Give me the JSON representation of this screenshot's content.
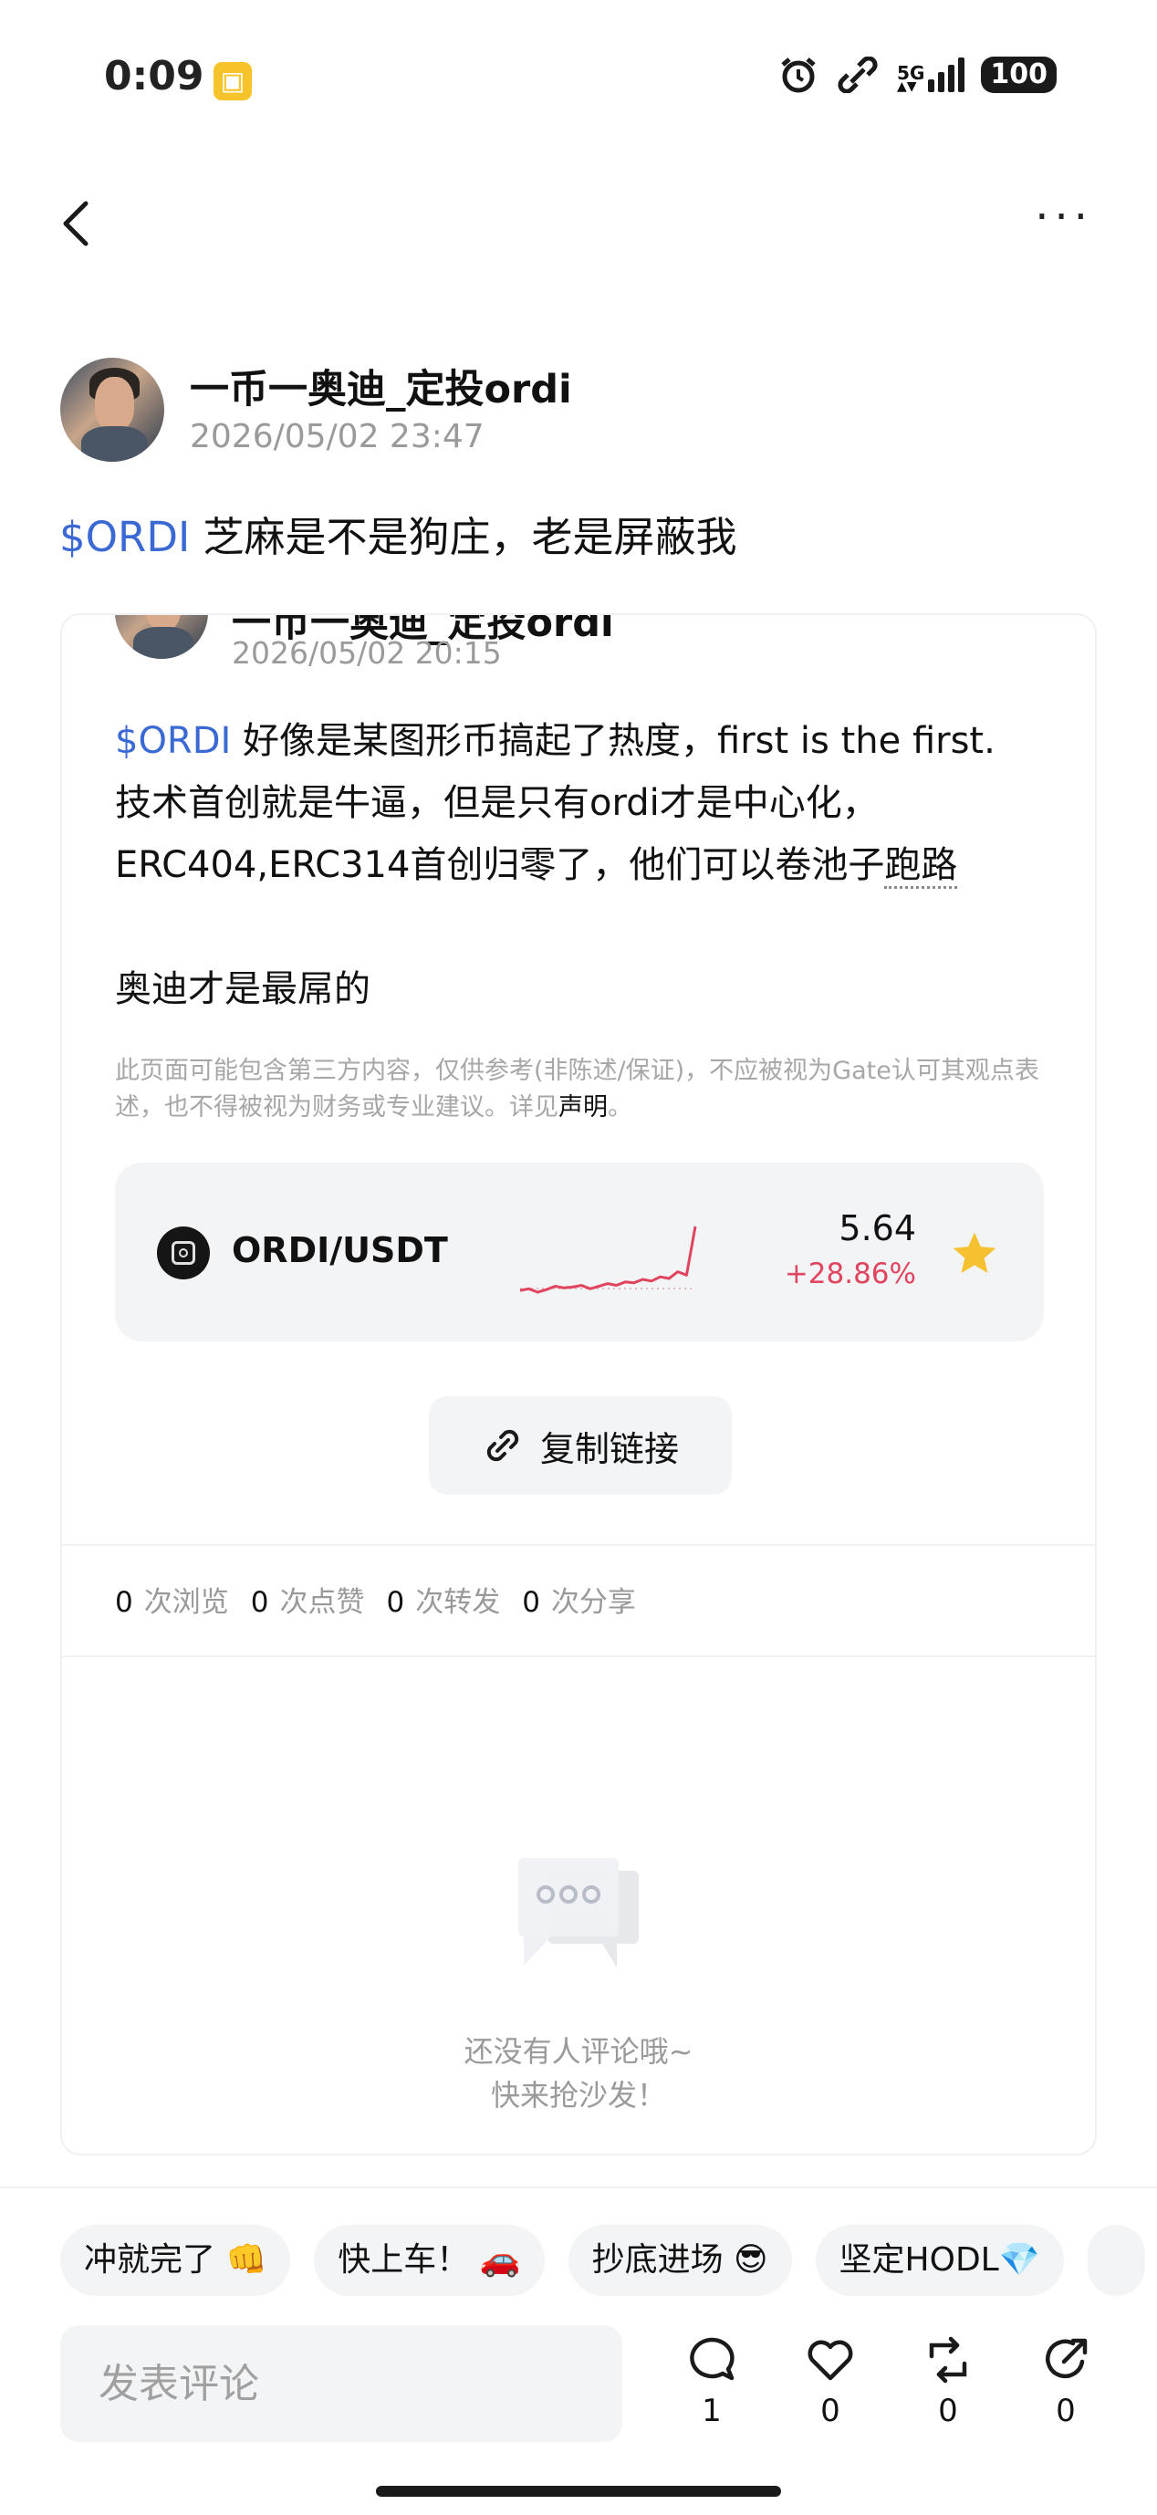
{
  "status_bar": {
    "time": "0:09",
    "network": "5G",
    "battery": "100"
  },
  "post": {
    "author": "一币一奥迪_定投ordi",
    "time": "2026/05/02 23:47",
    "ticker": "$ORDI",
    "text": " 芝麻是不是狗庄，老是屏蔽我"
  },
  "quoted": {
    "author_partial": "一币一奥迪_定投ordi",
    "time": "2026/05/02 20:15",
    "ticker": "$ORDI",
    "line1_rest": " 好像是某图形币搞起了热度，first is the first.",
    "line2": "技术首创就是牛逼，但是只有ordi才是中心化，",
    "line3_start": "ERC404,ERC314首创归零了，他们可以卷池子",
    "line3_link": "跑路",
    "line4": "奥迪才是最屌的",
    "disclaimer": "此页面可能包含第三方内容，仅供参考(非陈述/保证)，不应被视为Gate认可其观点表述，也不得被视为财务或专业建议。详见",
    "disclaimer_link": "声明",
    "disclaimer_end": "。"
  },
  "market": {
    "pair": "ORDI/USDT",
    "price": "5.64",
    "change": "+28.86%",
    "favorited": true,
    "sparkline": [
      2,
      2.2,
      1.8,
      2.1,
      2.5,
      2.3,
      2.4,
      2.6,
      2.2,
      2.5,
      2.8,
      2.6,
      3.0,
      2.9,
      3.3,
      3.1,
      3.6,
      3.4,
      4.2,
      3.8,
      9.5
    ]
  },
  "copy_link_label": "复制链接",
  "stats": [
    {
      "count": "0",
      "label": "次浏览"
    },
    {
      "count": "0",
      "label": "次点赞"
    },
    {
      "count": "0",
      "label": "次转发"
    },
    {
      "count": "0",
      "label": "次分享"
    }
  ],
  "empty": {
    "line1": "还没有人评论哦~",
    "line2": "快来抢沙发！"
  },
  "chips": [
    "冲就完了 👊",
    "快上车！ 🚗",
    "抄底进场 😎",
    "坚定HODL💎"
  ],
  "comment_placeholder": "发表评论",
  "actions": {
    "comments": "1",
    "likes": "0",
    "reposts": "0",
    "shares": "0"
  },
  "colors": {
    "ticker": "#3b69d4",
    "change": "#e0455f",
    "star": "#f5c130"
  }
}
